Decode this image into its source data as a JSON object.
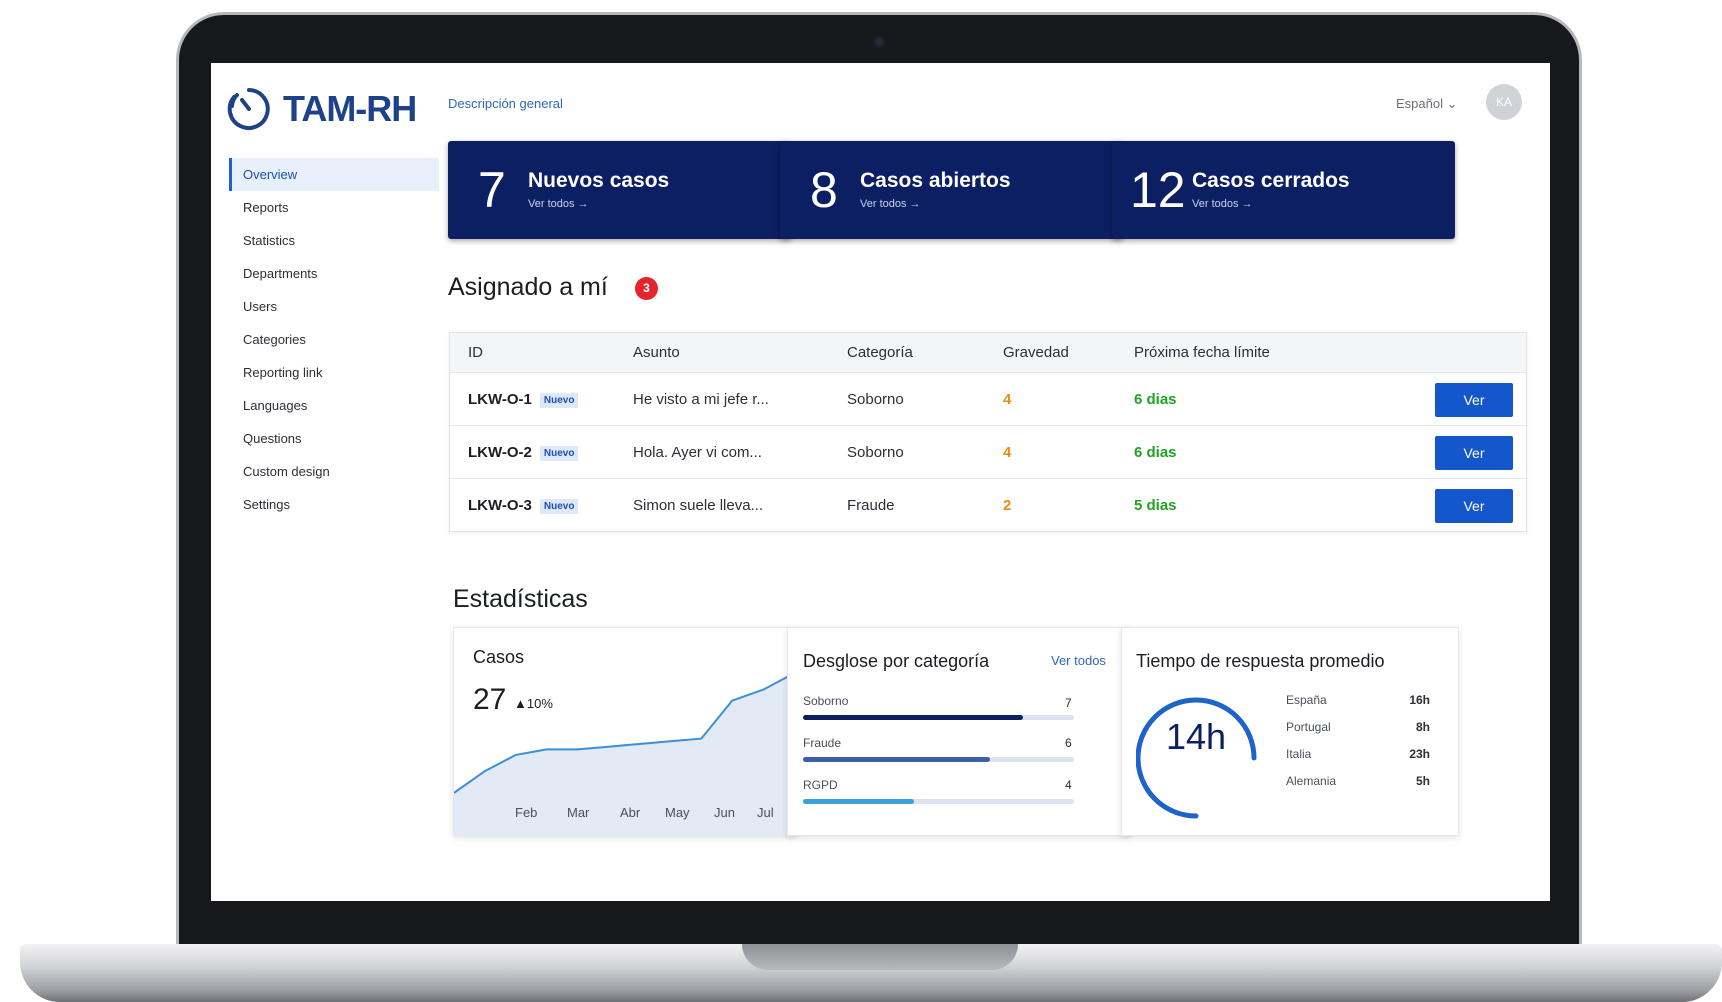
{
  "brand": {
    "name": "TAM-RH"
  },
  "sidebar": {
    "items": [
      {
        "label": "Overview",
        "active": true
      },
      {
        "label": "Reports"
      },
      {
        "label": "Statistics"
      },
      {
        "label": "Departments"
      },
      {
        "label": "Users"
      },
      {
        "label": "Categories"
      },
      {
        "label": "Reporting link"
      },
      {
        "label": "Languages"
      },
      {
        "label": "Questions"
      },
      {
        "label": "Custom design"
      },
      {
        "label": "Settings"
      }
    ]
  },
  "header": {
    "breadcrumb": "Descripción general",
    "language": "Español ⌄",
    "avatar_initials": "KA"
  },
  "kpis": [
    {
      "number": "7",
      "title": "Nuevos casos",
      "link": "Ver todos →"
    },
    {
      "number": "8",
      "title": "Casos abiertos",
      "link": "Ver todos →"
    },
    {
      "number": "12",
      "title": "Casos cerrados",
      "link": "Ver todos →"
    }
  ],
  "assigned": {
    "title": "Asignado a mí",
    "count": "3",
    "columns": [
      "ID",
      "Asunto",
      "Categoría",
      "Gravedad",
      "Próxima fecha límite"
    ],
    "rows": [
      {
        "id": "LKW-O-1",
        "tag": "Nuevo",
        "subject": "He visto a mi jefe r...",
        "category": "Soborno",
        "severity": "4",
        "due": "6 dias",
        "action": "Ver"
      },
      {
        "id": "LKW-O-2",
        "tag": "Nuevo",
        "subject": "Hola. Ayer vi com...",
        "category": "Soborno",
        "severity": "4",
        "due": "6 dias",
        "action": "Ver"
      },
      {
        "id": "LKW-O-3",
        "tag": "Nuevo",
        "subject": "Simon suele lleva...",
        "category": "Fraude",
        "severity": "2",
        "due": "5 dias",
        "action": "Ver"
      }
    ]
  },
  "stats": {
    "title": "Estadísticas",
    "cases": {
      "title": "Casos",
      "total": "27",
      "delta": "▲10%",
      "months": [
        "Feb",
        "Mar",
        "Abr",
        "May",
        "Jun",
        "Jul"
      ]
    },
    "breakdown": {
      "title": "Desglose por categoría",
      "link": "Ver todos",
      "items": [
        {
          "label": "Soborno",
          "value": "7",
          "fraction": 0.81,
          "color": "#0c1f63"
        },
        {
          "label": "Fraude",
          "value": "6",
          "fraction": 0.69,
          "color": "#3d5fa8"
        },
        {
          "label": "RGPD",
          "value": "4",
          "fraction": 0.41,
          "color": "#3aa0d8"
        }
      ]
    },
    "response": {
      "title": "Tiempo de respuesta promedio",
      "value": "14h",
      "countries": [
        {
          "name": "España",
          "time": "16h"
        },
        {
          "name": "Portugal",
          "time": "8h"
        },
        {
          "name": "Italia",
          "time": "23h"
        },
        {
          "name": "Alemania",
          "time": "5h"
        }
      ]
    }
  },
  "colors": {
    "primary": "#0c1f63",
    "accent": "#1456cc",
    "severity": "#f08a10",
    "due": "#23a323",
    "badge": "#e3262d"
  },
  "chart_data": {
    "type": "area",
    "title": "Casos",
    "categories": [
      "Feb",
      "Mar",
      "Abr",
      "May",
      "Jun",
      "Jul"
    ],
    "series": [
      {
        "values": [
          5,
          9,
          12,
          13,
          13,
          13.5,
          14,
          14.5,
          15,
          22,
          24,
          27
        ]
      }
    ],
    "grid": false
  }
}
